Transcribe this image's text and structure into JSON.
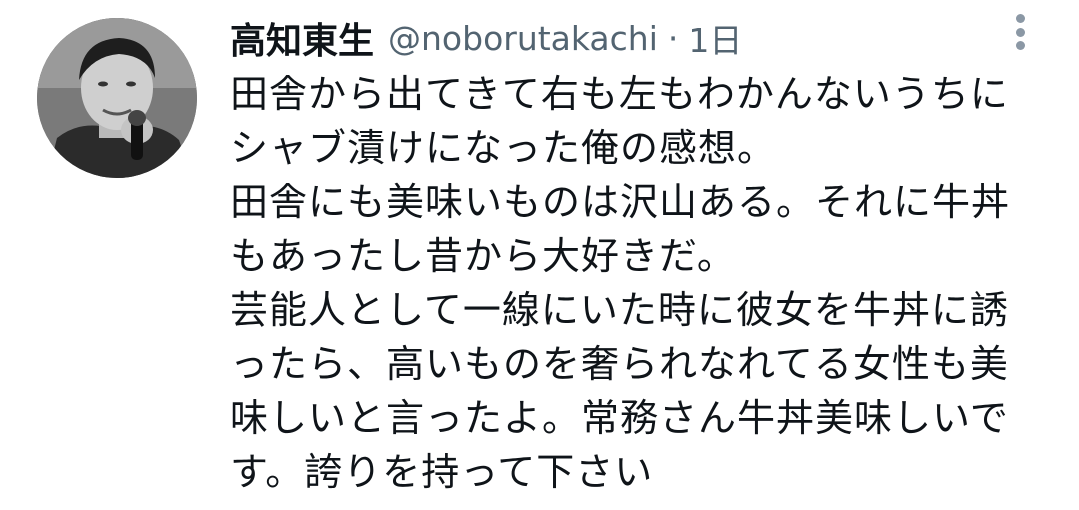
{
  "tweet": {
    "author": {
      "display_name": "高知東生",
      "handle": "@noborutakachi",
      "separator": "·",
      "timestamp": "1日"
    },
    "more_icon": "more-vertical-icon",
    "text_lines": [
      "田舎から出てきて右も左もわかんないうちに",
      "シャブ漬けになった俺の感想。",
      "田舎にも美味いものは沢山ある。それに牛丼",
      "もあったし昔から大好きだ。",
      "芸能人として一線にいた時に彼女を牛丼に誘",
      "ったら、高いものを奢られなれてる女性も美",
      "味しいと言ったよ。常務さん牛丼美味しいで",
      "す。誇りを持って下さい"
    ]
  },
  "colors": {
    "text_primary": "#0f1419",
    "text_secondary": "#536471",
    "icon_gray": "#8b98a5",
    "background": "#ffffff"
  }
}
